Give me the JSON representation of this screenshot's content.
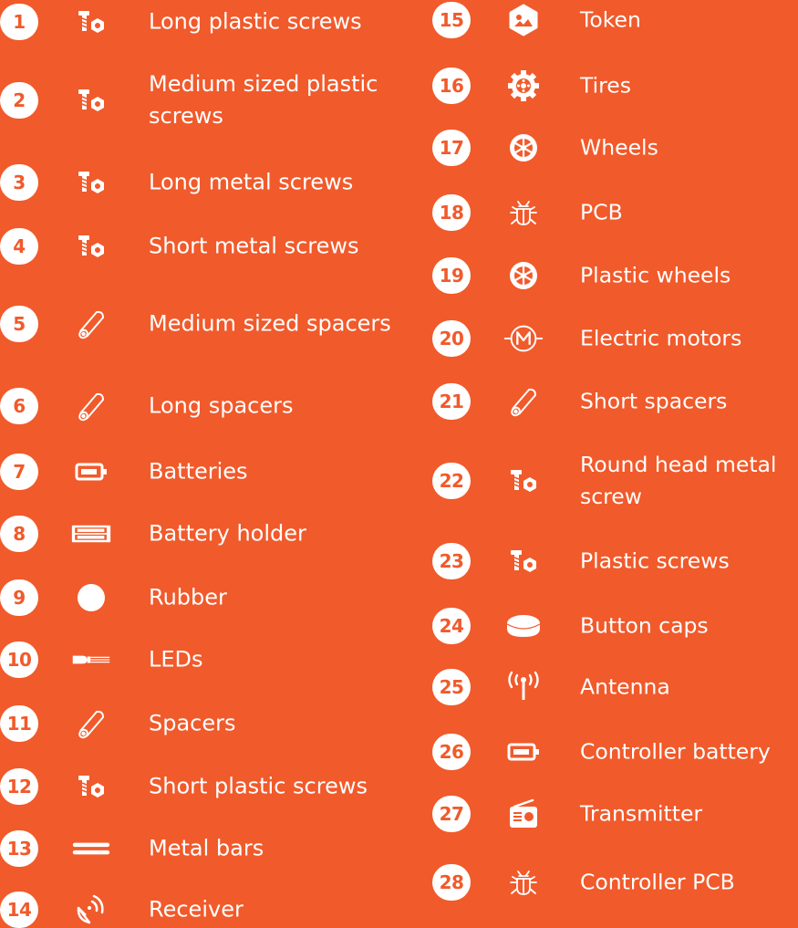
{
  "colors": {
    "background": "#F15A2B",
    "foreground": "#FFFFFF"
  },
  "parts": [
    {
      "number": "1",
      "label": "Long plastic screws",
      "icon": "screw-nut-icon"
    },
    {
      "number": "2",
      "label": "Medium sized plastic screws",
      "icon": "screw-nut-icon"
    },
    {
      "number": "3",
      "label": "Long metal screws",
      "icon": "screw-nut-icon"
    },
    {
      "number": "4",
      "label": "Short metal screws",
      "icon": "screw-nut-icon"
    },
    {
      "number": "5",
      "label": "Medium sized spacers",
      "icon": "spacer-icon"
    },
    {
      "number": "6",
      "label": "Long spacers",
      "icon": "spacer-icon"
    },
    {
      "number": "7",
      "label": "Batteries",
      "icon": "battery-icon"
    },
    {
      "number": "8",
      "label": "Battery holder",
      "icon": "battery-holder-icon"
    },
    {
      "number": "9",
      "label": "Rubber",
      "icon": "rubber-icon"
    },
    {
      "number": "10",
      "label": "LEDs",
      "icon": "led-icon"
    },
    {
      "number": "11",
      "label": "Spacers",
      "icon": "spacer-icon"
    },
    {
      "number": "12",
      "label": "Short plastic screws",
      "icon": "screw-nut-icon"
    },
    {
      "number": "13",
      "label": "Metal bars",
      "icon": "metal-bars-icon"
    },
    {
      "number": "14",
      "label": "Receiver",
      "icon": "receiver-icon"
    },
    {
      "number": "15",
      "label": "Token",
      "icon": "token-icon"
    },
    {
      "number": "16",
      "label": "Tires",
      "icon": "tire-icon"
    },
    {
      "number": "17",
      "label": "Wheels",
      "icon": "wheel-icon"
    },
    {
      "number": "18",
      "label": "PCB",
      "icon": "pcb-icon"
    },
    {
      "number": "19",
      "label": "Plastic wheels",
      "icon": "wheel-icon"
    },
    {
      "number": "20",
      "label": "Electric motors",
      "icon": "motor-icon"
    },
    {
      "number": "21",
      "label": "Short spacers",
      "icon": "spacer-icon"
    },
    {
      "number": "22",
      "label": "Round head metal screw",
      "icon": "screw-nut-icon"
    },
    {
      "number": "23",
      "label": "Plastic screws",
      "icon": "screw-nut-icon"
    },
    {
      "number": "24",
      "label": "Button caps",
      "icon": "button-cap-icon"
    },
    {
      "number": "25",
      "label": "Antenna",
      "icon": "antenna-icon"
    },
    {
      "number": "26",
      "label": "Controller battery",
      "icon": "battery-icon"
    },
    {
      "number": "27",
      "label": "Transmitter",
      "icon": "transmitter-icon"
    },
    {
      "number": "28",
      "label": "Controller PCB",
      "icon": "pcb-icon"
    }
  ]
}
